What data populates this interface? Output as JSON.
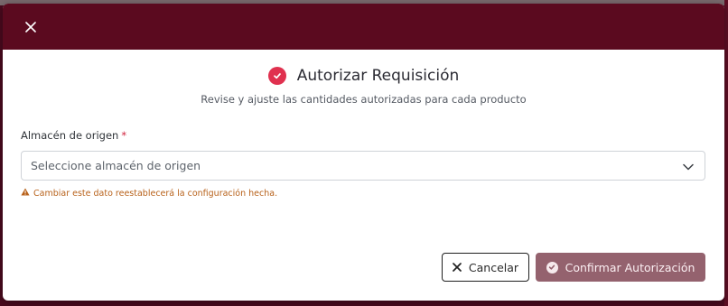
{
  "dialog": {
    "title": "Autorizar Requisición",
    "subtitle": "Revise y ajuste las cantidades autorizadas para cada producto",
    "close_icon": "close-icon",
    "title_icon": "check-circle-icon"
  },
  "form": {
    "origin_label": "Almacén de origen",
    "required_mark": "*",
    "origin_placeholder": "Seleccione almacén de origen",
    "warning_icon": "warning-icon",
    "warning_text": "Cambiar este dato reestablecerá la configuración hecha."
  },
  "actions": {
    "cancel_label": "Cancelar",
    "confirm_label": "Confirmar Autorización"
  },
  "colors": {
    "header": "#5b0a1f",
    "accent": "#e0314f",
    "confirm_button": "#94626e",
    "warning": "#b8621b"
  }
}
